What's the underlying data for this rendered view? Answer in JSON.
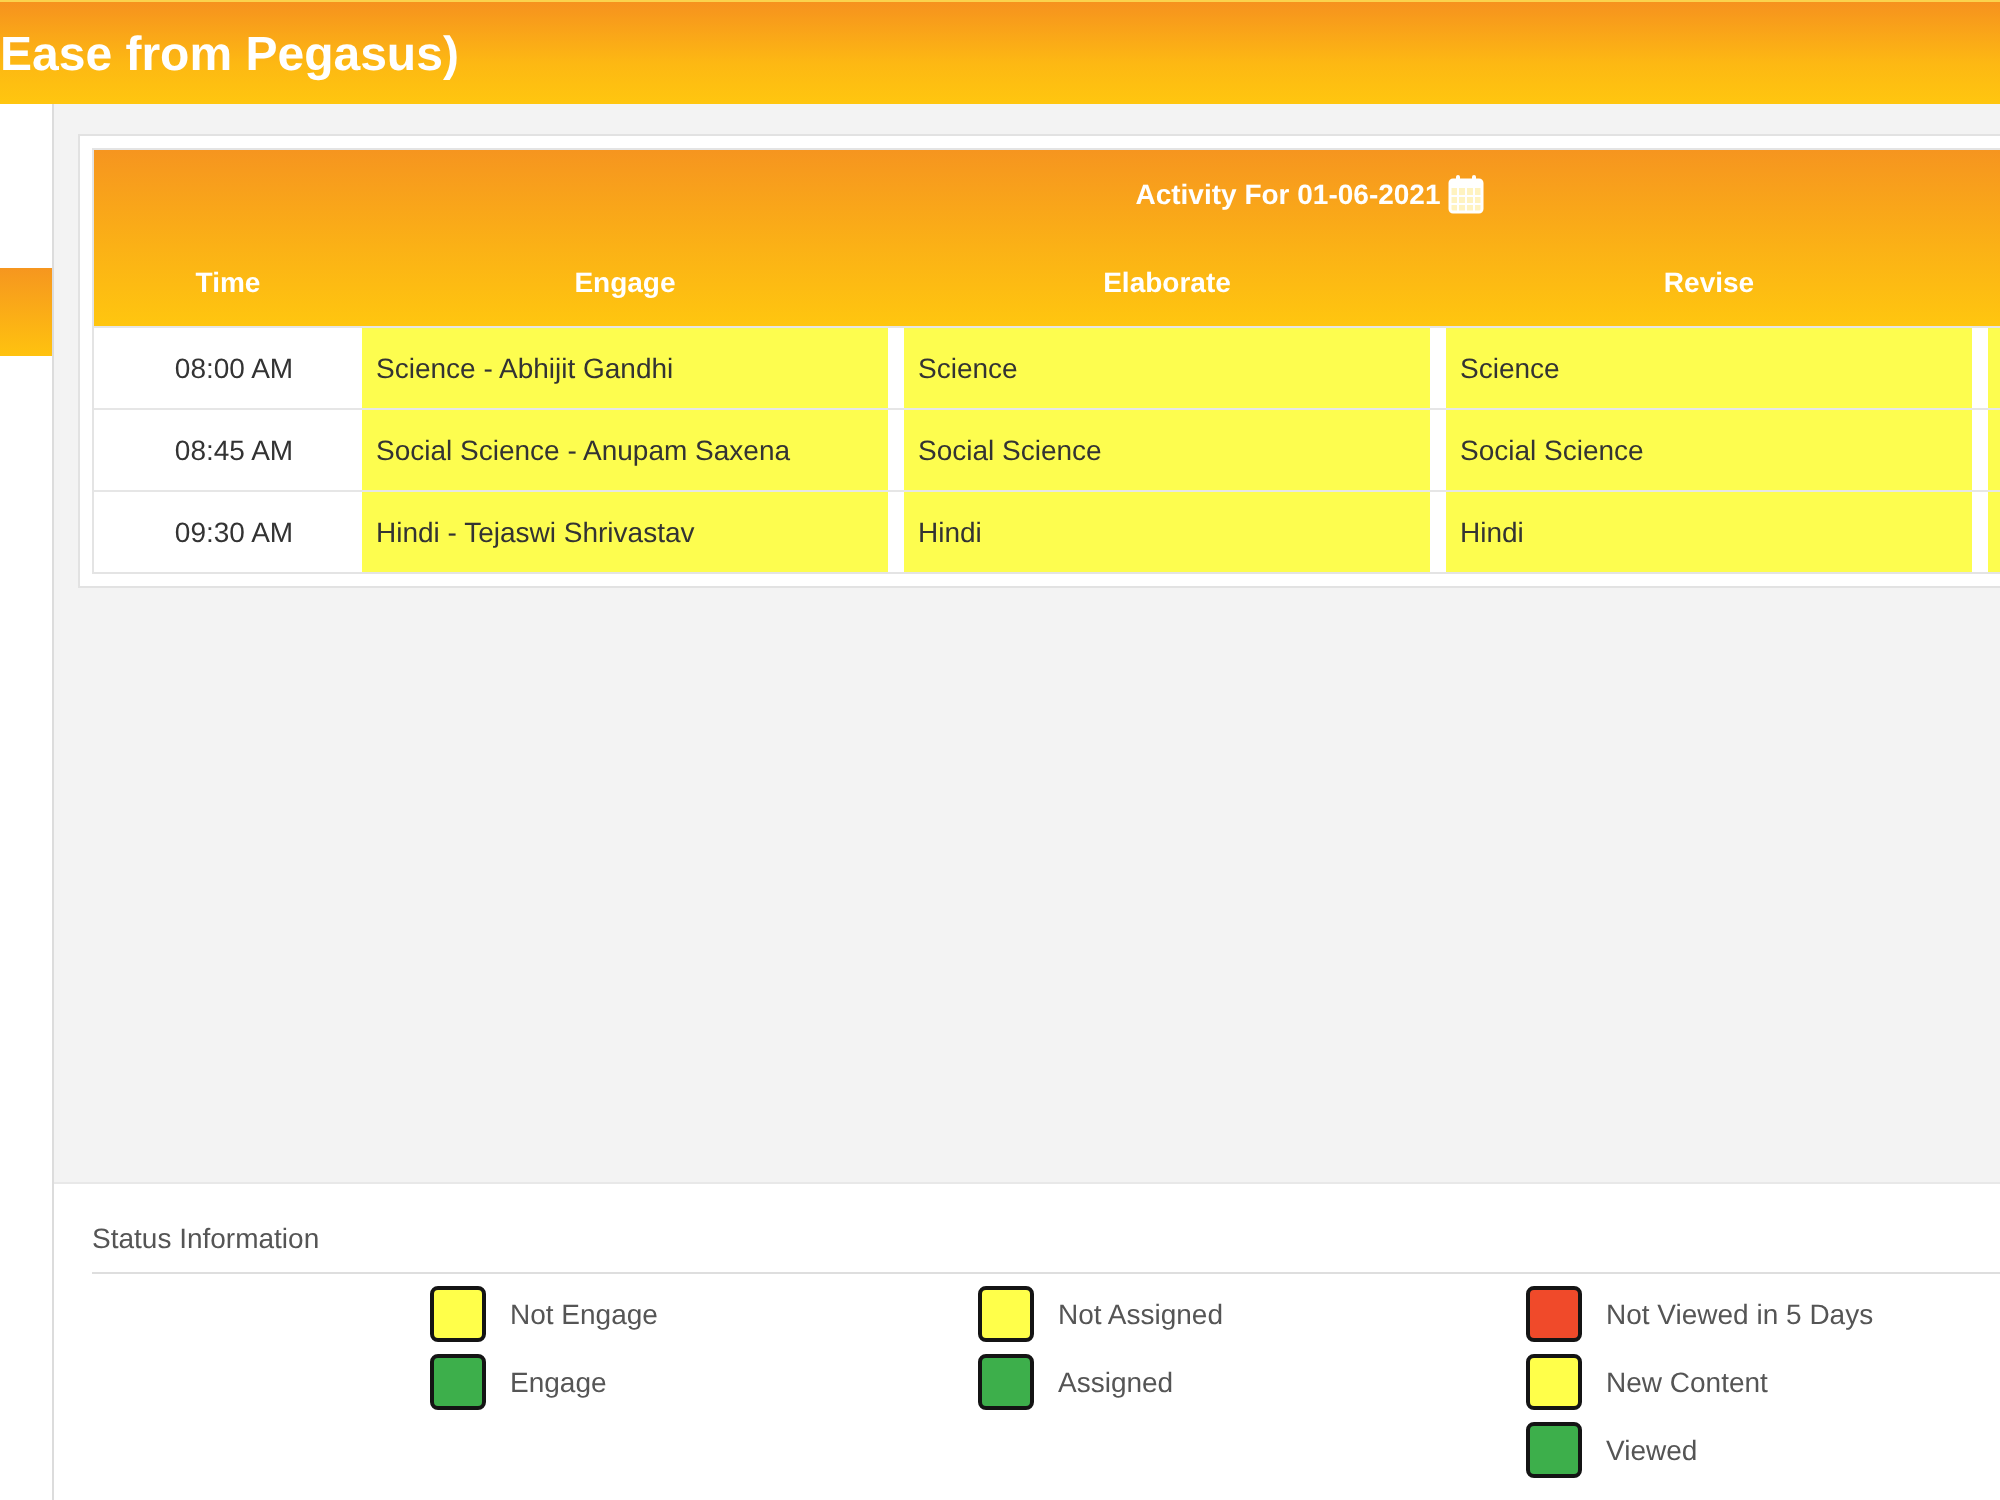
{
  "header": {
    "title": "Ease from Pegasus)"
  },
  "sidebar": {
    "items": [
      {
        "selected": true
      }
    ]
  },
  "activity_table": {
    "title": "Activity For 01-06-2021",
    "columns": [
      "Time",
      "Engage",
      "Elaborate",
      "Revise"
    ],
    "rows": [
      {
        "cells": [
          "08:00 AM",
          "Science - Abhijit Gandhi",
          "Science",
          "Science"
        ]
      },
      {
        "cells": [
          "08:45 AM",
          "Social Science - Anupam Saxena",
          "Social Science",
          "Social Science"
        ]
      },
      {
        "cells": [
          "09:30 AM",
          "Hindi - Tejaswi Shrivastav",
          "Hindi",
          "Hindi"
        ]
      }
    ]
  },
  "status_information": {
    "title": "Status Information",
    "groups": [
      {
        "items": [
          {
            "label": "Not Engage",
            "color": "#ffff4a"
          },
          {
            "label": "Engage",
            "color": "#3daf4b"
          }
        ]
      },
      {
        "items": [
          {
            "label": "Not Assigned",
            "color": "#ffff4a"
          },
          {
            "label": "Assigned",
            "color": "#3daf4b"
          }
        ]
      },
      {
        "items": [
          {
            "label": "Not Viewed in 5 Days",
            "color": "#f04a2a"
          },
          {
            "label": "New Content",
            "color": "#ffff4a"
          },
          {
            "label": "Viewed",
            "color": "#3daf4b"
          }
        ]
      }
    ]
  }
}
